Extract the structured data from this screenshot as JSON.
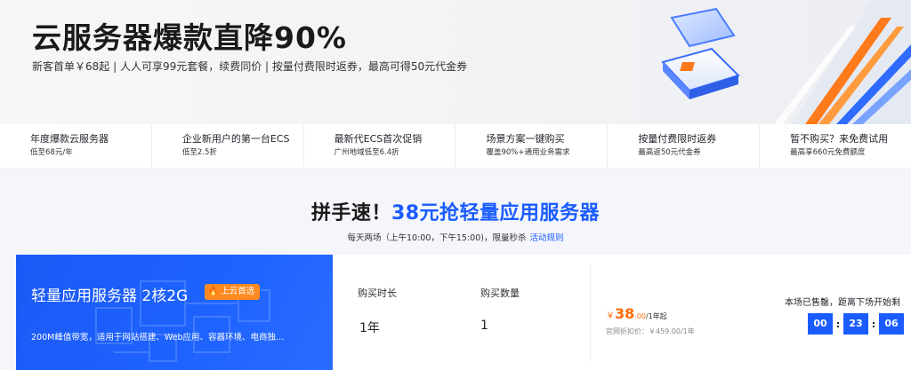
{
  "hero": {
    "title": "云服务器爆款直降90%",
    "subtitle": "新客首单￥68起 | 人人可享99元套餐，续费同价 | 按量付费限时返券，最高可得50元代金券"
  },
  "features": [
    {
      "title": "年度爆款云服务器",
      "desc": "低至68元/年"
    },
    {
      "title": "企业新用户的第一台ECS",
      "desc": "低至2.5折"
    },
    {
      "title": "最新代ECS首次促销",
      "desc": "广州地域低至6.4折"
    },
    {
      "title": "场景方案一键购买",
      "desc": "覆盖90%+通用业务需求"
    },
    {
      "title": "按量付费限时返券",
      "desc": "最高返50元代金券"
    },
    {
      "title": "暂不购买？来免费试用",
      "desc": "最高享660元免费额度"
    }
  ],
  "promo": {
    "title_dark": "拼手速！",
    "title_blue": "38元抢轻量应用服务器",
    "subtitle": "每天两场（上午10:00，下午15:00)，限量秒杀",
    "rules_link": "活动规则"
  },
  "product": {
    "name": "轻量应用服务器 2核2G",
    "tag": "上云首选",
    "desc": "200M峰值带宽，适用于网站搭建、Web应用、容器环境、电商独...",
    "duration_label": "购买时长",
    "duration_value": "1年",
    "quantity_label": "购买数量",
    "quantity_value": "1",
    "price_symbol": "￥",
    "price_int": "38",
    "price_dec": ".00",
    "price_unit": "/1年起",
    "original_price": "官网折扣价：￥459.00/1年",
    "sold_text": "本场已售罄，距离下场开始剩",
    "countdown": {
      "h": "00",
      "m": "23",
      "s": "06",
      "sep": ":"
    }
  },
  "colors": {
    "accent": "#1a5cff",
    "price": "#ff6a00",
    "tag": "#ff8a1f"
  }
}
